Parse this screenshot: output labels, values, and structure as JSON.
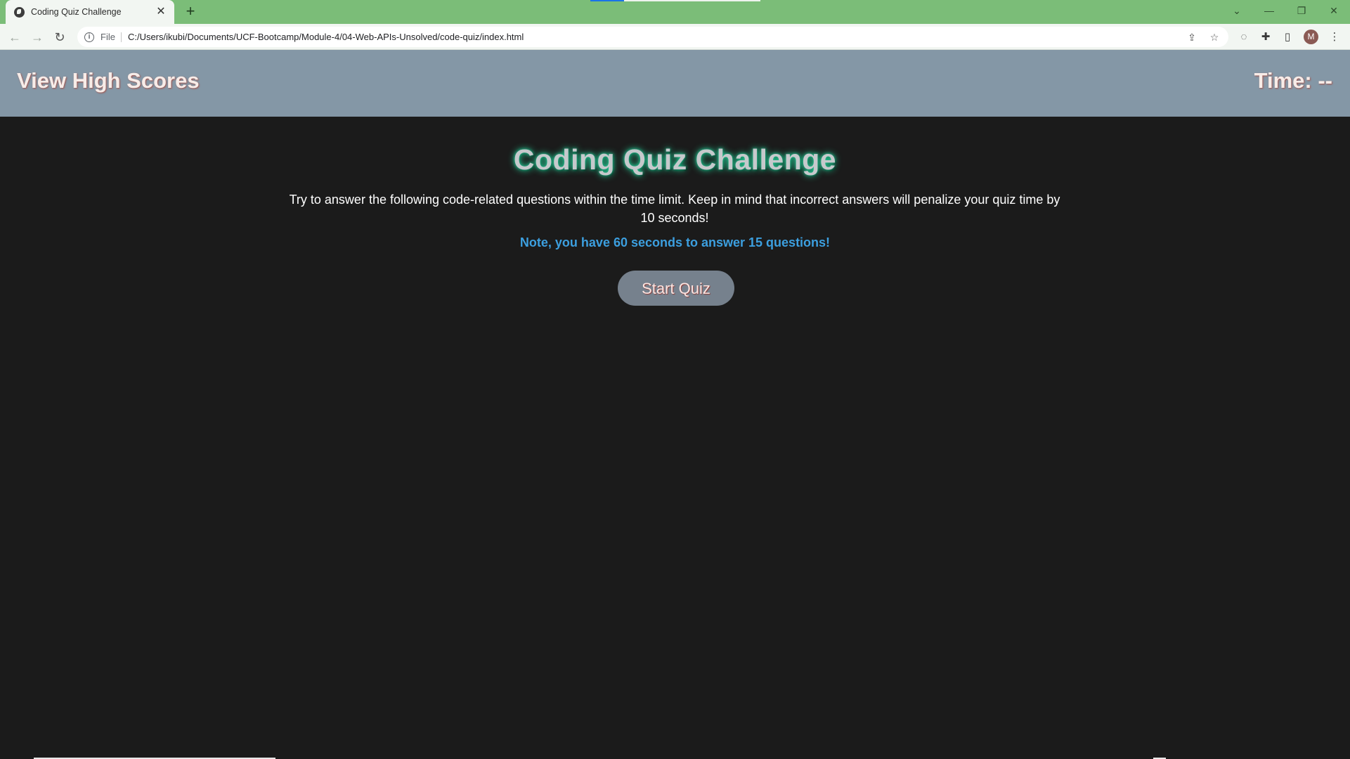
{
  "browser": {
    "tab_title": "Coding Quiz Challenge",
    "tab_close": "✕",
    "new_tab": "+",
    "url_scheme": "File",
    "url": "C:/Users/ikubi/Documents/UCF-Bootcamp/Module-4/04-Web-APIs-Unsolved/code-quiz/index.html",
    "avatar_initial": "M",
    "accent_color": "#7bbd78"
  },
  "header": {
    "high_scores_label": "View High Scores",
    "timer_label": "Time: --"
  },
  "main": {
    "title": "Coding Quiz Challenge",
    "instructions": "Try to answer the following code-related questions within the time limit. Keep in mind that incorrect answers will penalize your quiz time by 10 seconds!",
    "note": "Note, you have 60 seconds to answer 15 questions!",
    "start_button": "Start Quiz"
  },
  "colors": {
    "header_bg": "#8497a6",
    "page_bg": "#1b1b1b",
    "note": "#3c9fdf",
    "button_bg": "#76818d",
    "title_glow": "#2be6a8"
  }
}
